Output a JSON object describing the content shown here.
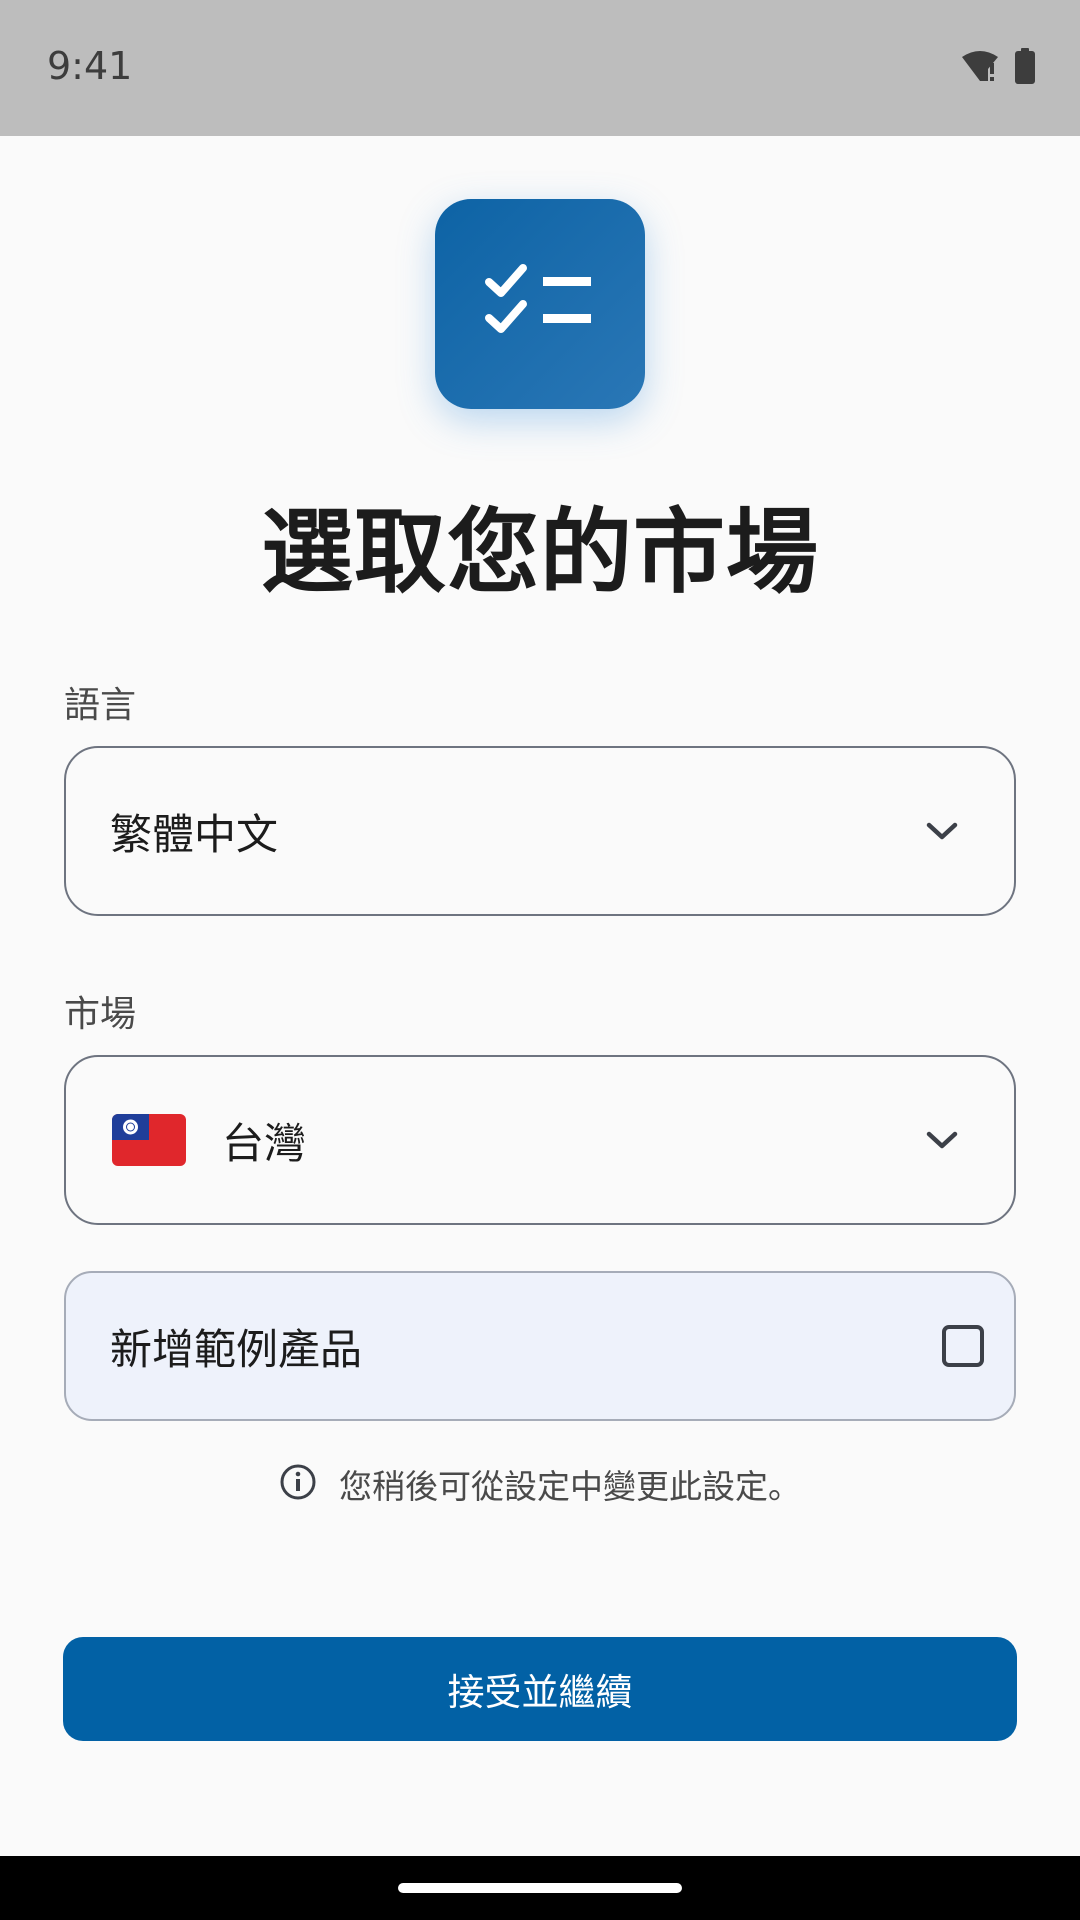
{
  "status_bar": {
    "time": "9:41",
    "icons": [
      "wifi-alert-icon",
      "battery-icon"
    ]
  },
  "app": {
    "icon": "checklist-icon",
    "brand_color": "#0261a5"
  },
  "header": {
    "title": "選取您的市場"
  },
  "language": {
    "label": "語言",
    "value": "繁體中文",
    "icon": "chevron-down-icon"
  },
  "market": {
    "label": "市場",
    "value": "台灣",
    "flag": "taiwan-flag-icon",
    "icon": "chevron-down-icon"
  },
  "sample_products": {
    "label": "新增範例產品",
    "checked": false
  },
  "info": {
    "icon": "info-icon",
    "text": "您稍後可從設定中變更此設定。"
  },
  "actions": {
    "continue_label": "接受並繼續"
  }
}
